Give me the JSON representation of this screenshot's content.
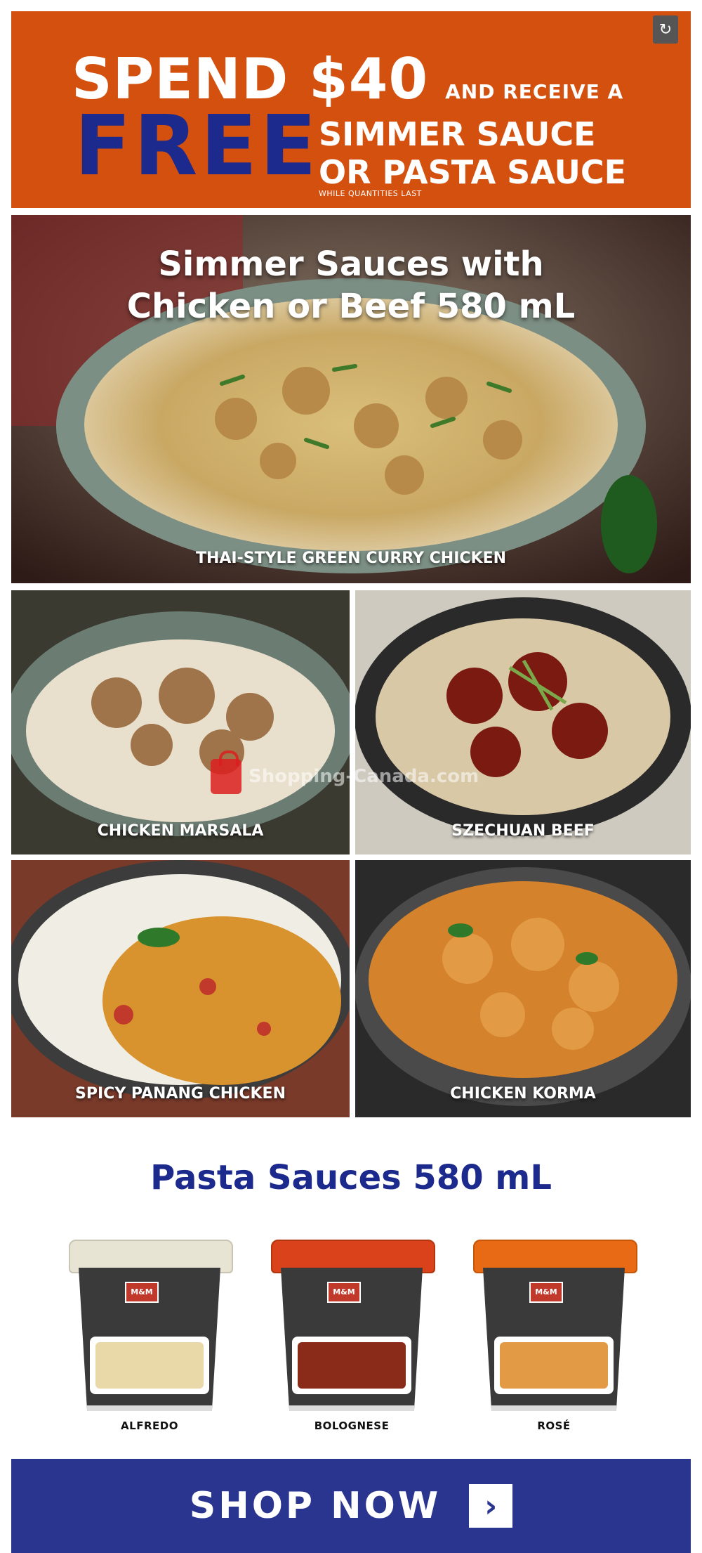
{
  "banner": {
    "spend": "SPEND $40",
    "receive": "AND RECEIVE A",
    "free": "FREE",
    "line1": "SIMMER SAUCE",
    "line2": "OR PASTA SAUCE",
    "fineprint": "WHILE QUANTITIES LAST",
    "share_icon": "share-icon"
  },
  "hero": {
    "title_line1": "Simmer Sauces with",
    "title_line2": "Chicken or Beef 580 mL",
    "caption": "THAI-STYLE GREEN CURRY CHICKEN"
  },
  "tiles": [
    {
      "label": "CHICKEN MARSALA"
    },
    {
      "label": "SZECHUAN BEEF"
    },
    {
      "label": "SPICY PANANG CHICKEN"
    },
    {
      "label": "CHICKEN KORMA"
    }
  ],
  "watermark": "Shopping-Canada.com",
  "pasta": {
    "title": "Pasta Sauces 580 mL",
    "brand": "M&M",
    "products": [
      {
        "label": "ALFREDO",
        "lid": "#e8e4d4",
        "food": "#e9d9a8"
      },
      {
        "label": "BOLOGNESE",
        "lid": "#d9421a",
        "food": "#8a2a18"
      },
      {
        "label": "ROSÉ",
        "lid": "#e86a14",
        "food": "#e39a45"
      }
    ]
  },
  "cta": {
    "label": "SHOP NOW",
    "arrow": "chevron-right-icon"
  },
  "colors": {
    "banner_orange": "#d4500f",
    "navy": "#1b2a8c",
    "cta_blue": "#2a3590"
  }
}
